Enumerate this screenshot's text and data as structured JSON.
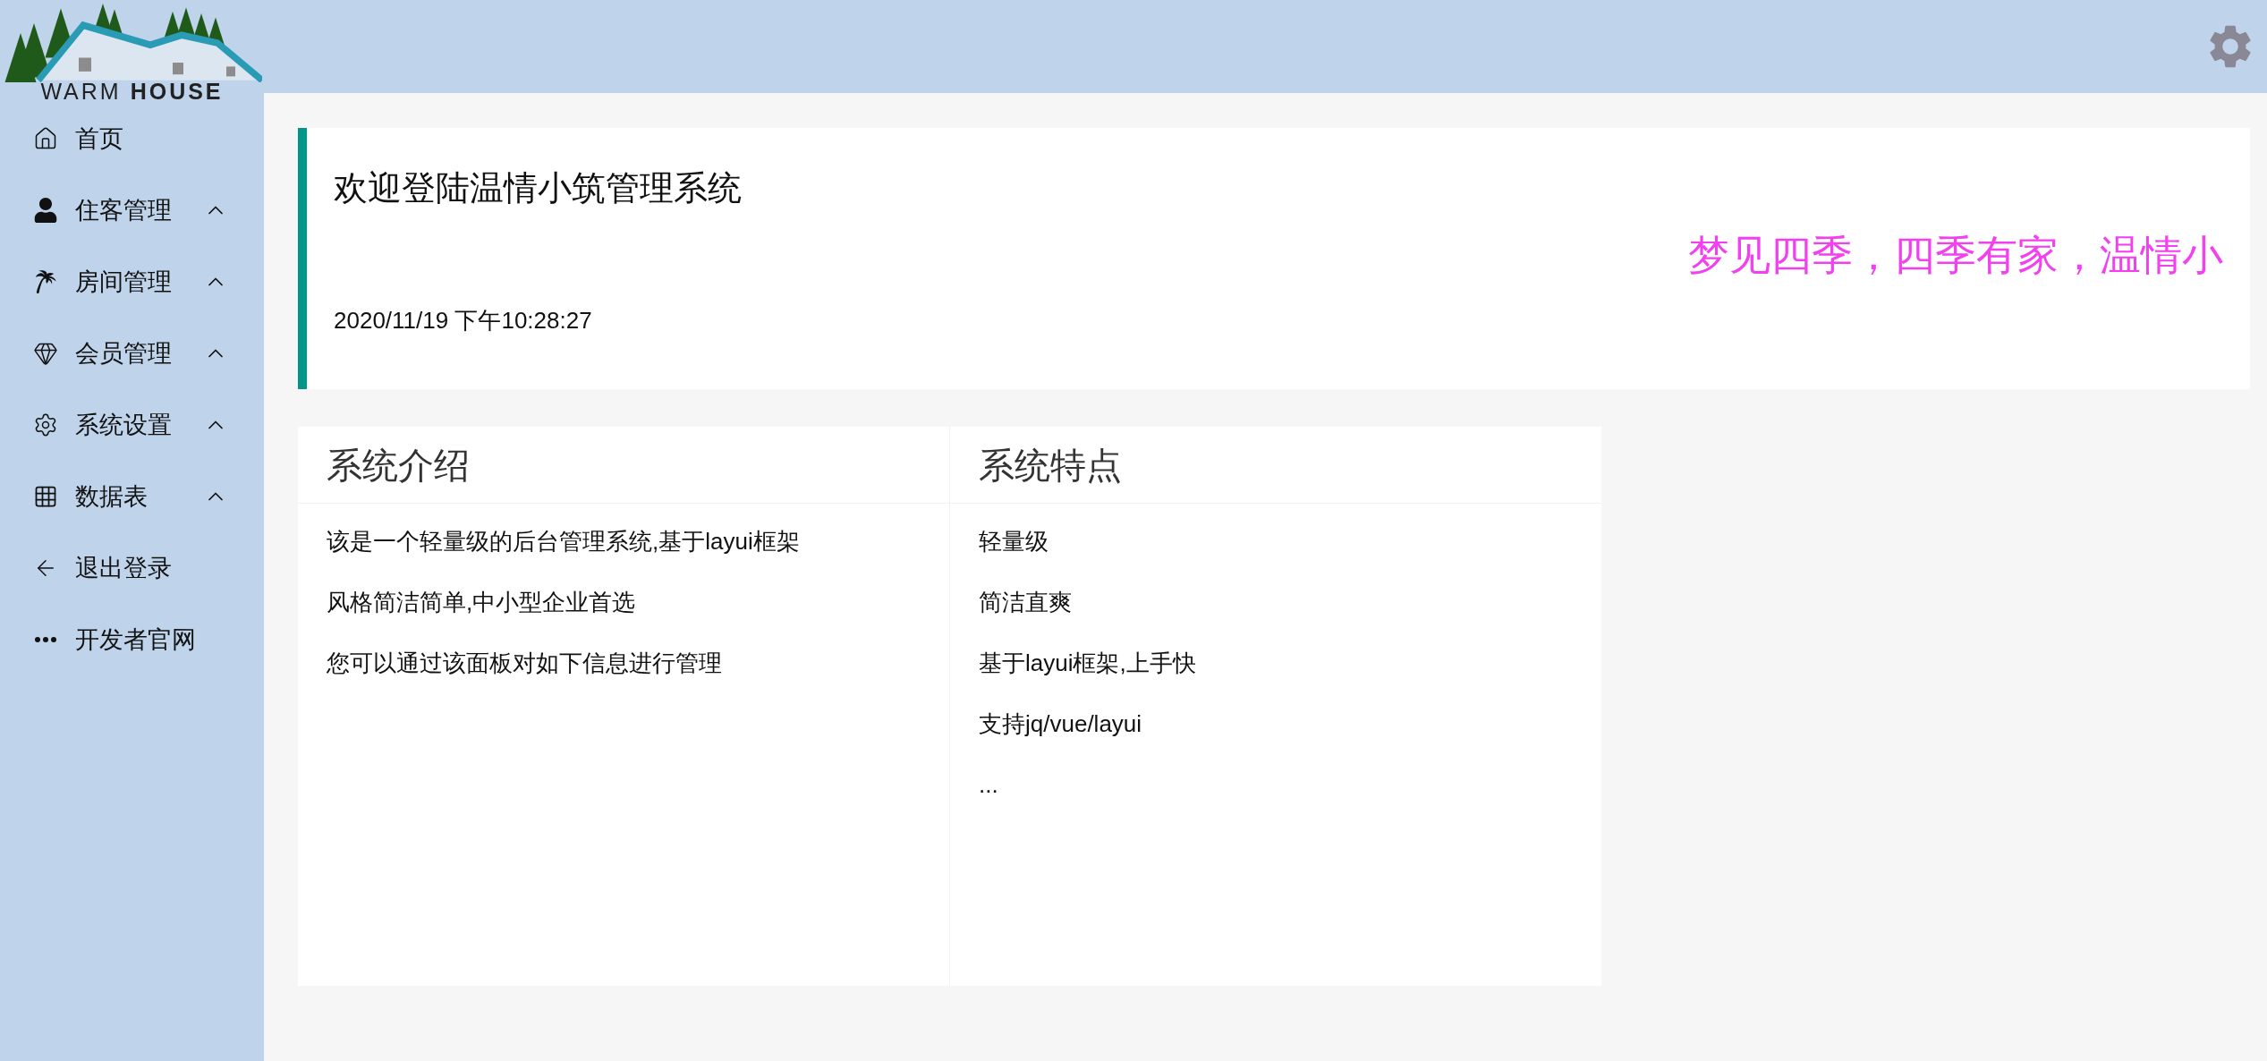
{
  "logo": {
    "text": "WARM **HOUSE**"
  },
  "sidebar": {
    "items": [
      {
        "label": "首页",
        "has_submenu": false
      },
      {
        "label": "住客管理",
        "has_submenu": true
      },
      {
        "label": "房间管理",
        "has_submenu": true
      },
      {
        "label": "会员管理",
        "has_submenu": true
      },
      {
        "label": "系统设置",
        "has_submenu": true
      },
      {
        "label": "数据表",
        "has_submenu": true
      },
      {
        "label": "退出登录",
        "has_submenu": false
      },
      {
        "label": "开发者官网",
        "has_submenu": false
      }
    ]
  },
  "welcome": {
    "title": "欢迎登陆温情小筑管理系统",
    "slogan": "梦见四季，四季有家，温情小",
    "datetime": "2020/11/19 下午10:28:27"
  },
  "panels": [
    {
      "title": "系统介绍",
      "lines": [
        "该是一个轻量级的后台管理系统,基于layui框架",
        "风格简洁简单,中小型企业首选",
        "您可以通过该面板对如下信息进行管理"
      ]
    },
    {
      "title": "系统特点",
      "lines": [
        "轻量级",
        "简洁直爽",
        "基于layui框架,上手快",
        "支持jq/vue/layui",
        "..."
      ]
    }
  ]
}
